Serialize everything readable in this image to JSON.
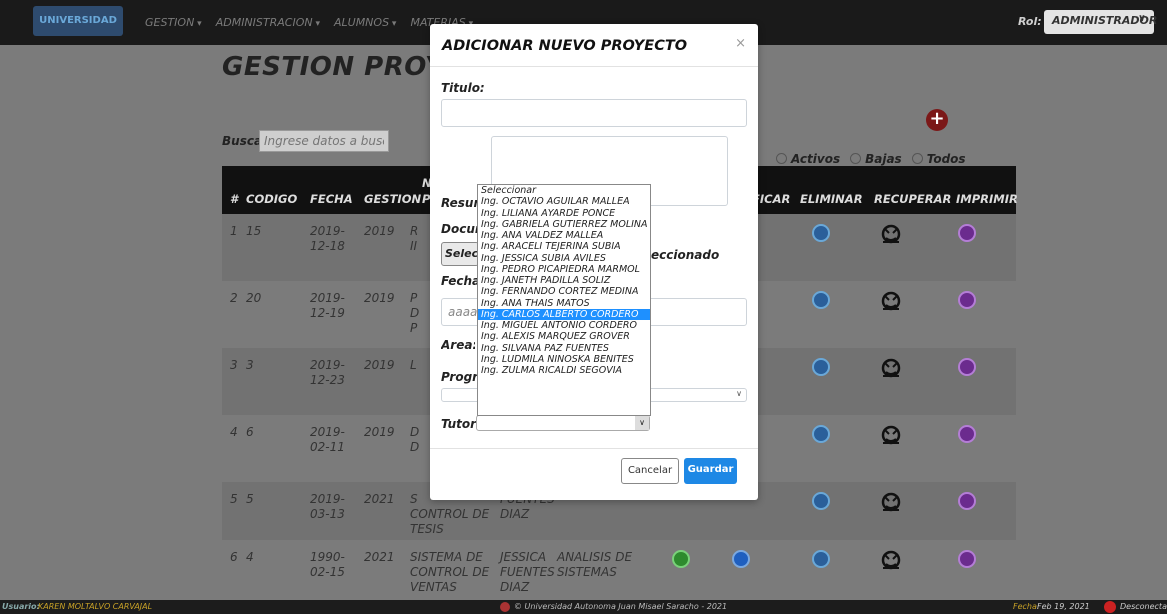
{
  "navbar": {
    "logo_text": "UNIVERSIDAD",
    "menu": [
      "GESTION",
      "ADMINISTRACION",
      "ALUMNOS",
      "MATERIAS"
    ],
    "role_label": "Rol:",
    "role_value": "ADMINISTRADOR"
  },
  "page": {
    "title": "GESTION PROYECTOS",
    "search_label": "Buscar",
    "search_placeholder": "Ingrese datos a buscar...",
    "filters": [
      "Activos",
      "Bajas",
      "Todos"
    ]
  },
  "table": {
    "headers": [
      "#",
      "CODIGO",
      "FECHA",
      "GESTION",
      "N",
      "P",
      "FICAR",
      "ELIMINAR",
      "RECUPERAR",
      "IMPRIMIR"
    ],
    "rows": [
      {
        "num": "1",
        "code": "15",
        "date": "2019-\n12-18",
        "gestion": "2019",
        "name": "R\nII",
        "author": "",
        "area": ""
      },
      {
        "num": "2",
        "code": "20",
        "date": "2019-\n12-19",
        "gestion": "2019",
        "name": "P\nD\nP",
        "author": "",
        "area": ""
      },
      {
        "num": "3",
        "code": "3",
        "date": "2019-\n12-23",
        "gestion": "2019",
        "name": "L",
        "author": "",
        "area": ""
      },
      {
        "num": "4",
        "code": "6",
        "date": "2019-\n02-11",
        "gestion": "2019",
        "name": "D\nD",
        "author": "",
        "area": ""
      },
      {
        "num": "5",
        "code": "5",
        "date": "2019-\n03-13",
        "gestion": "2021",
        "name": "S\nCONTROL DE\nTESIS",
        "author": "FUENTES\nDIAZ",
        "area": ""
      },
      {
        "num": "6",
        "code": "4",
        "date": "1990-\n02-15",
        "gestion": "2021",
        "name": "SISTEMA DE\nCONTROL DE\nVENTAS",
        "author": "JESSICA\nFUENTES\nDIAZ",
        "area": "ANALISIS DE\nSISTEMAS"
      }
    ]
  },
  "footer": {
    "user_label": "Usuario:",
    "user_name": "KAREN MOLTALVO CARVAJAL",
    "copyright": "© Universidad Autonoma Juan Misael Saracho - 2021",
    "date_label": "Fecha:",
    "date": "Feb 19, 2021",
    "logout": "Desconectar"
  },
  "modal": {
    "title": "ADICIONAR NUEVO PROYECTO",
    "close": "×",
    "titulo_label": "Titulo:",
    "resumen_label": "Resumen:",
    "documento_label": "Documento:",
    "select_file_button": "Seleccionar",
    "no_file_text": "eccionado",
    "fecha_label": "Fecha:",
    "fecha_placeholder": "aaaa",
    "area_label": "Area:",
    "programa_label": "Programa:",
    "tutor_label": "Tutor:",
    "cancel_button": "Cancelar",
    "save_button": "Guardar"
  },
  "tutor_dropdown": {
    "options": [
      "Seleccionar",
      "Ing. OCTAVIO AGUILAR MALLEA",
      "Ing. LILIANA AYARDE PONCE",
      "Ing. GABRIELA GUTIERREZ MOLINA",
      "Ing. ANA VALDEZ MALLEA",
      "Ing. ARACELI TEJERINA SUBIA",
      "Ing. JESSICA SUBIA AVILES",
      "Ing. PEDRO PICAPIEDRA MARMOL",
      "Ing. JANETH PADILLA SOLIZ",
      "Ing. FERNANDO CORTEZ MEDINA",
      "Ing. ANA THAIS MATOS",
      "Ing. CARLOS ALBERTO CORDERO",
      "Ing. MIGUEL ANTONIO CORDERO",
      "Ing. ALEXIS MARQUEZ GROVER",
      "Ing. SILVANA PAZ FUENTES",
      "Ing. LUDMILA NINOSKA BENITES",
      "Ing. ZULMA RICALDI SEGOVIA"
    ],
    "highlighted": "Ing. CARLOS ALBERTO CORDERO"
  },
  "colors": {
    "primary_button": "#1e88e5",
    "overlay": "#7b7b7b",
    "add_icon": "#7b1818"
  }
}
